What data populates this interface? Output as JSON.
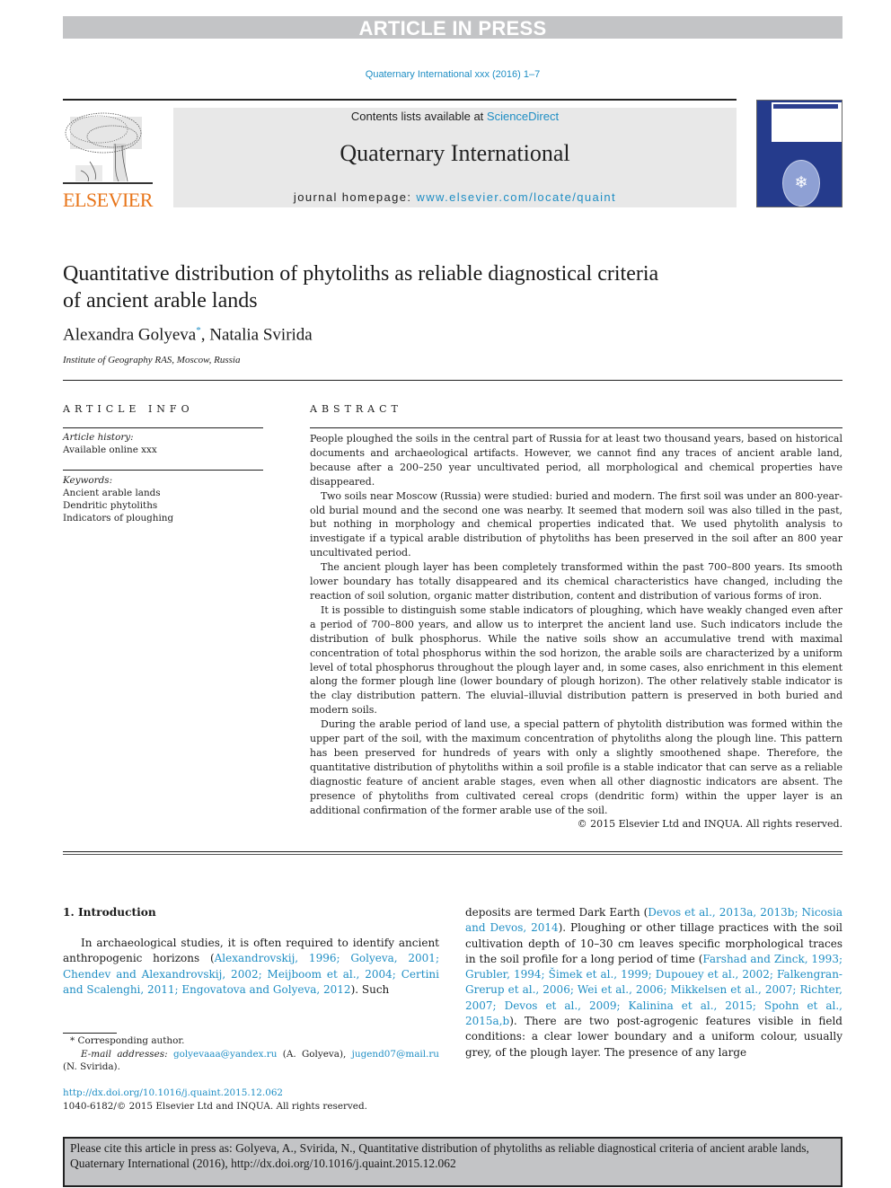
{
  "banner": {
    "text": "ARTICLE IN PRESS"
  },
  "journal_ref": "Quaternary International xxx (2016) 1–7",
  "masthead": {
    "publisher_wordmark": "ELSEVIER",
    "contents_prefix": "Contents lists available at ",
    "contents_link": "ScienceDirect",
    "journal_name": "Quaternary International",
    "homepage_prefix": "journal homepage: ",
    "homepage_link": "www.elsevier.com/locate/quaint",
    "logo_icon": "elsevier-tree-icon",
    "cover_icon": "journal-cover-icon"
  },
  "article": {
    "title_line1": "Quantitative distribution of phytoliths as reliable diagnostical criteria",
    "title_line2": "of ancient arable lands",
    "author1": "Alexandra Golyeva",
    "author1_mark": "*",
    "author_sep": ", ",
    "author2": "Natalia Svirida",
    "affiliation": "Institute of Geography RAS, Moscow, Russia"
  },
  "article_info": {
    "heading": "ARTICLE INFO",
    "history_label": "Article history:",
    "history_value": "Available online xxx",
    "keywords_label": "Keywords:",
    "keywords": [
      "Ancient arable lands",
      "Dendritic phytoliths",
      "Indicators of ploughing"
    ]
  },
  "abstract": {
    "heading": "ABSTRACT",
    "paragraphs": [
      "People ploughed the soils in the central part of Russia for at least two thousand years, based on historical documents and archaeological artifacts. However, we cannot find any traces of ancient arable land, because after a 200–250 year uncultivated period, all morphological and chemical properties have disappeared.",
      "Two soils near Moscow (Russia) were studied: buried and modern. The first soil was under an 800-year-old burial mound and the second one was nearby. It seemed that modern soil was also tilled in the past, but nothing in morphology and chemical properties indicated that. We used phytolith analysis to investigate if a typical arable distribution of phytoliths has been preserved in the soil after an 800 year uncultivated period.",
      "The ancient plough layer has been completely transformed within the past 700–800 years. Its smooth lower boundary has totally disappeared and its chemical characteristics have changed, including the reaction of soil solution, organic matter distribution, content and distribution of various forms of iron.",
      "It is possible to distinguish some stable indicators of ploughing, which have weakly changed even after a period of 700–800 years, and allow us to interpret the ancient land use. Such indicators include the distribution of bulk phosphorus. While the native soils show an accumulative trend with maximal concentration of total phosphorus within the sod horizon, the arable soils are characterized by a uniform level of total phosphorus throughout the plough layer and, in some cases, also enrichment in this element along the former plough line (lower boundary of plough horizon). The other relatively stable indicator is the clay distribution pattern. The eluvial–illuvial distribution pattern is preserved in both buried and modern soils.",
      "During the arable period of land use, a special pattern of phytolith distribution was formed within the upper part of the soil, with the maximum concentration of phytoliths along the plough line. This pattern has been preserved for hundreds of years with only a slightly smoothened shape. Therefore, the quantitative distribution of phytoliths within a soil profile is a stable indicator that can serve as a reliable diagnostic feature of ancient arable stages, even when all other diagnostic indicators are absent. The presence of phytoliths from cultivated cereal crops (dendritic form) within the upper layer is an additional confirmation of the former arable use of the soil."
    ],
    "copyright": "© 2015 Elsevier Ltd and INQUA. All rights reserved."
  },
  "introduction": {
    "heading": "1.  Introduction",
    "left_text_1": "In archaeological studies, it is often required to identify ancient anthropogenic horizons (",
    "left_refs_1": "Alexandrovskij, 1996; Golyeva, 2001; Chendev and Alexandrovskij, 2002; Meijboom et al., 2004; Certini and Scalenghi, 2011; Engovatova and Golyeva, 2012",
    "left_text_2": "). Such",
    "right_text_1": "deposits are termed Dark Earth (",
    "right_refs_1": "Devos et al., 2013a, 2013b; Nicosia and Devos, 2014",
    "right_text_2": "). Ploughing or other tillage practices with the soil cultivation depth of 10–30 cm leaves specific morphological traces in the soil profile for a long period of time (",
    "right_refs_2": "Farshad and Zinck, 1993; Grubler, 1994; Šimek et al., 1999; Dupouey et al., 2002; Falkengran-Grerup et al., 2006; Wei et al., 2006; Mikkelsen et al., 2007; Richter, 2007; Devos et al., 2009; Kalinina et al., 2015; Spohn et al., 2015a,b",
    "right_text_3": "). There are two post-agrogenic features visible in field conditions: a clear lower boundary and a uniform colour, usually grey, of the plough layer. The presence of any large"
  },
  "footnotes": {
    "corresponding_mark": "*",
    "corresponding_text": " Corresponding author.",
    "email_label": "E-mail addresses:",
    "email1": "golyevaaa@yandex.ru",
    "email1_owner": " (A. Golyeva), ",
    "email2": "jugend07@mail.ru",
    "email2_owner": "(N. Svirida).",
    "doi_link": "http://dx.doi.org/10.1016/j.quaint.2015.12.062",
    "issn_line": "1040-6182/© 2015 Elsevier Ltd and INQUA. All rights reserved."
  },
  "citation_box": {
    "text": "Please cite this article in press as: Golyeva, A., Svirida, N., Quantitative distribution of phytoliths as reliable diagnostical criteria of ancient arable lands, Quaternary International (2016), http://dx.doi.org/10.1016/j.quaint.2015.12.062"
  }
}
